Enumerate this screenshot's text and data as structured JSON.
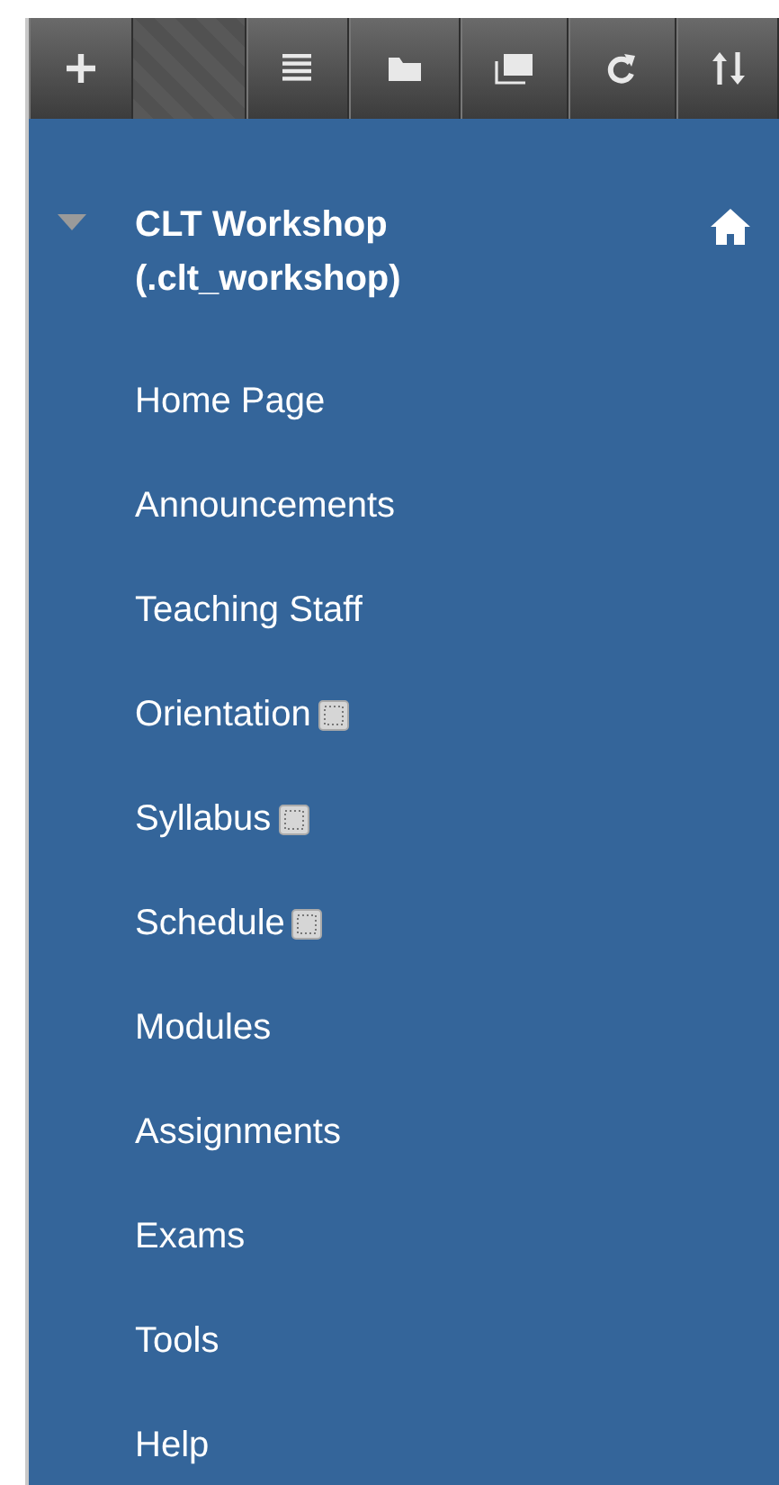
{
  "toolbar": {
    "buttons": [
      {
        "kind": "add"
      },
      {
        "kind": "blank"
      },
      {
        "kind": "list"
      },
      {
        "kind": "folder"
      },
      {
        "kind": "windows"
      },
      {
        "kind": "refresh"
      },
      {
        "kind": "sort"
      }
    ]
  },
  "course": {
    "title": "CLT Workshop",
    "code": "(.clt_workshop)",
    "expanded": true
  },
  "menu_items": [
    {
      "label": "Home Page",
      "hidden": false
    },
    {
      "label": "Announcements",
      "hidden": false
    },
    {
      "label": "Teaching Staff",
      "hidden": false
    },
    {
      "label": "Orientation",
      "hidden": true
    },
    {
      "label": "Syllabus",
      "hidden": true
    },
    {
      "label": "Schedule",
      "hidden": true
    },
    {
      "label": "Modules",
      "hidden": false
    },
    {
      "label": "Assignments",
      "hidden": false
    },
    {
      "label": "Exams",
      "hidden": false
    },
    {
      "label": "Tools",
      "hidden": false
    },
    {
      "label": "Help",
      "hidden": false
    }
  ]
}
